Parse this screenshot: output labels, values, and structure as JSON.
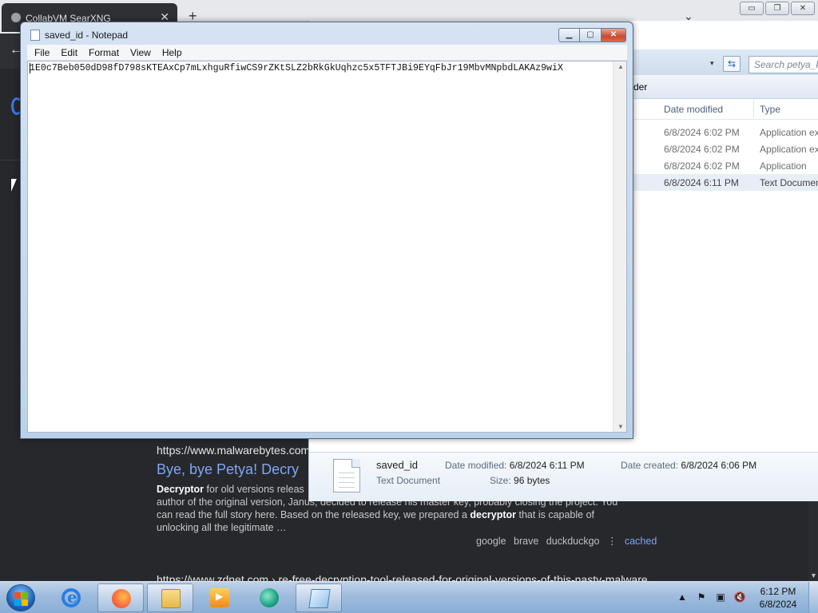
{
  "browser": {
    "tab_title": "CollabVM SearXNG",
    "tab_close": "✕",
    "new_tab": "+",
    "tabstrip_chevron": "⌄",
    "window_controls": [
      "▭",
      "❐",
      "✕"
    ],
    "back_icon": "←",
    "result": {
      "url": "https://www.malwarebytes.com",
      "title": "Bye, bye Petya! Decry",
      "snippet_parts": [
        {
          "text": "Decryptor",
          "bold": true
        },
        {
          "text": " for old versions releas",
          "bold": false
        },
        {
          "text": "author of the original version, Janus, decided to release his master key, probably closing the project. You can read the full story here. Based on the released key, we prepared a ",
          "bold": false
        },
        {
          "text": "decryptor",
          "bold": true
        },
        {
          "text": " that is capable of unlocking all the legitimate …",
          "bold": false
        }
      ],
      "engines": [
        "google",
        "brave",
        "duckduckgo"
      ],
      "engines_sep": "⋮",
      "cached": "cached"
    },
    "next_result_url": "https://www.zdnet.com › re-free-decryption-tool-released-for-original-versions-of-this-nasty-malware"
  },
  "explorer": {
    "search_placeholder": "Search petya_ke",
    "refresh_icon": "⇆",
    "dropdown_icon": "▾",
    "cmdbar_fragment": "der",
    "columns": {
      "date": "Date modified",
      "type": "Type"
    },
    "rows": [
      {
        "date": "6/8/2024 6:02 PM",
        "type": "Application ex",
        "selected": false
      },
      {
        "date": "6/8/2024 6:02 PM",
        "type": "Application ex",
        "selected": false
      },
      {
        "date": "6/8/2024 6:02 PM",
        "type": "Application",
        "selected": false
      },
      {
        "date": "6/8/2024 6:11 PM",
        "type": "Text Document",
        "selected": true
      }
    ],
    "details": {
      "name": "saved_id",
      "type": "Text Document",
      "modified_label": "Date modified:",
      "modified_value": "6/8/2024 6:11 PM",
      "size_label": "Size:",
      "size_value": "96 bytes",
      "created_label": "Date created:",
      "created_value": "6/8/2024 6:06 PM"
    }
  },
  "notepad": {
    "title": "saved_id - Notepad",
    "controls": {
      "minimize": "▁",
      "maximize": "▢",
      "close": "✕"
    },
    "menu": [
      "File",
      "Edit",
      "Format",
      "View",
      "Help"
    ],
    "content": "1E0c7Beb050dD98fD798sKTEAxCp7mLxhguRfiwCS9rZKtSLZ2bRkGkUqhzc5x5TFTJBi9EYqFbJr19MbvMNpbdLAKAz9wiX",
    "scroll_up": "▲",
    "scroll_down": "▼"
  },
  "taskbar": {
    "apps": [
      {
        "name": "internet-explorer-icon",
        "open": false
      },
      {
        "name": "firefox-icon",
        "open": true
      },
      {
        "name": "file-explorer-icon",
        "open": true
      },
      {
        "name": "media-player-icon",
        "open": false
      },
      {
        "name": "app-swirl-icon",
        "open": false
      },
      {
        "name": "notepad-icon",
        "open": true
      }
    ],
    "tray_icons": [
      "▲",
      "⚑",
      "▣",
      "🔇"
    ],
    "clock_time": "6:12 PM",
    "clock_date": "6/8/2024"
  }
}
